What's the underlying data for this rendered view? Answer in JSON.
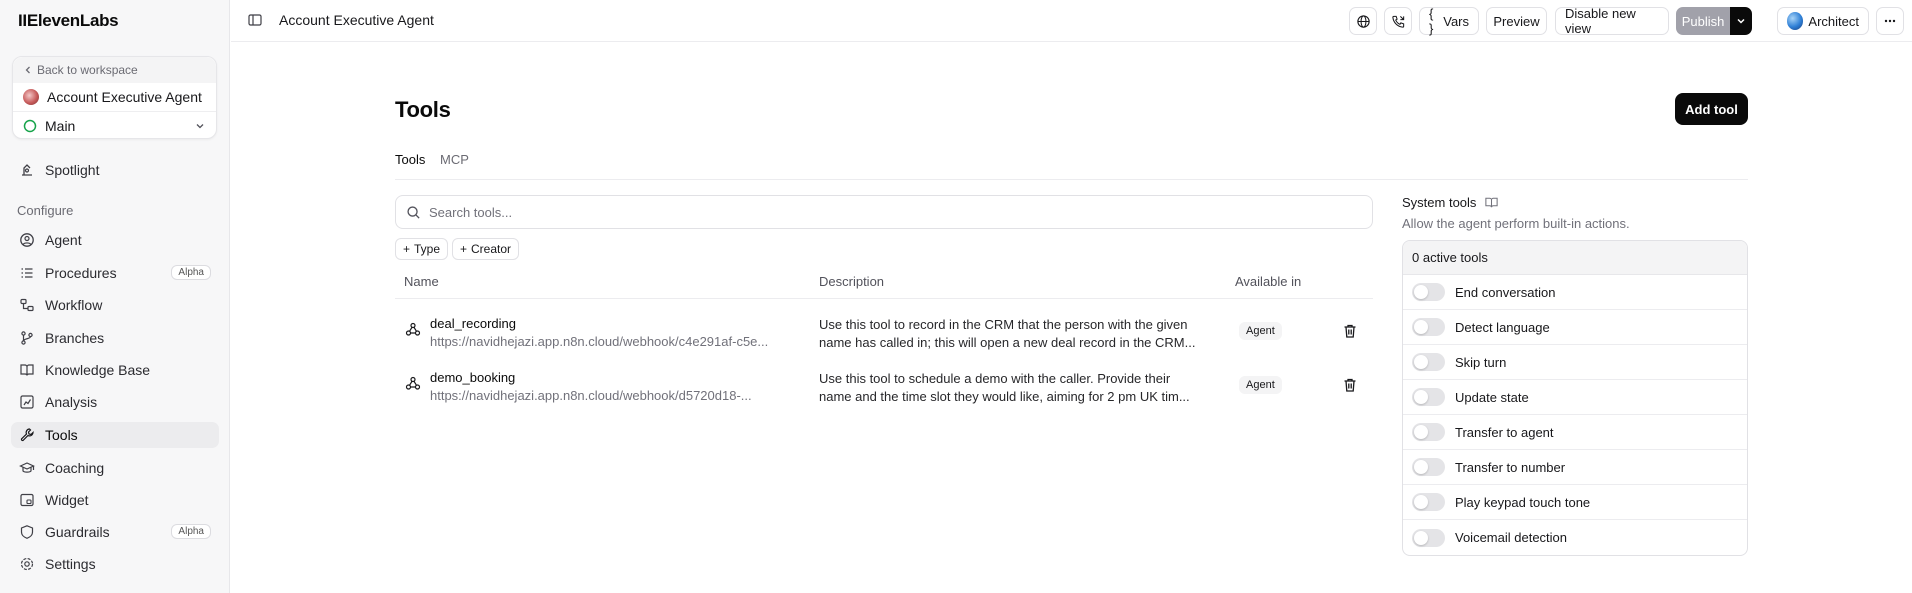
{
  "brand": "IIElevenLabs",
  "workspace": {
    "back_label": "Back to workspace",
    "agent_name": "Account Executive Agent",
    "branch": "Main"
  },
  "sidebar": {
    "items_top": [
      {
        "label": "Spotlight"
      }
    ],
    "section": "Configure",
    "items": [
      {
        "label": "Agent"
      },
      {
        "label": "Procedures",
        "badge": "Alpha"
      },
      {
        "label": "Workflow"
      },
      {
        "label": "Branches"
      },
      {
        "label": "Knowledge Base"
      },
      {
        "label": "Analysis"
      },
      {
        "label": "Tools"
      },
      {
        "label": "Coaching"
      },
      {
        "label": "Widget"
      },
      {
        "label": "Guardrails",
        "badge": "Alpha"
      },
      {
        "label": "Settings"
      }
    ]
  },
  "topbar": {
    "title": "Account Executive Agent",
    "vars": "Vars",
    "vars_prefix": "{ }",
    "preview": "Preview",
    "disable_view": "Disable new view",
    "publish": "Publish",
    "architect": "Architect"
  },
  "main": {
    "title": "Tools",
    "add_tool": "Add tool",
    "tabs": [
      {
        "label": "Tools"
      },
      {
        "label": "MCP"
      }
    ],
    "search_placeholder": "Search tools...",
    "filters": [
      {
        "label": "Type"
      },
      {
        "label": "Creator"
      }
    ],
    "columns": [
      "Name",
      "Description",
      "Available in"
    ],
    "rows": [
      {
        "name": "deal_recording",
        "url": "https://navidhejazi.app.n8n.cloud/webhook/c4e291af-c5e...",
        "desc1": "Use this tool to record in the CRM that the person with the given",
        "desc2": "name has called in; this will open a new deal record in the CRM...",
        "available": "Agent"
      },
      {
        "name": "demo_booking",
        "url": "https://navidhejazi.app.n8n.cloud/webhook/d5720d18-...",
        "desc1": "Use this tool to schedule a demo with the caller. Provide their",
        "desc2": "name and the time slot they would like, aiming for 2 pm UK tim...",
        "available": "Agent"
      }
    ]
  },
  "system_tools": {
    "title": "System tools",
    "subtitle": "Allow the agent perform built-in actions.",
    "active_count": "0 active tools",
    "items": [
      {
        "label": "End conversation"
      },
      {
        "label": "Detect language"
      },
      {
        "label": "Skip turn"
      },
      {
        "label": "Update state"
      },
      {
        "label": "Transfer to agent"
      },
      {
        "label": "Transfer to number"
      },
      {
        "label": "Play keypad touch tone"
      },
      {
        "label": "Voicemail detection"
      }
    ]
  }
}
